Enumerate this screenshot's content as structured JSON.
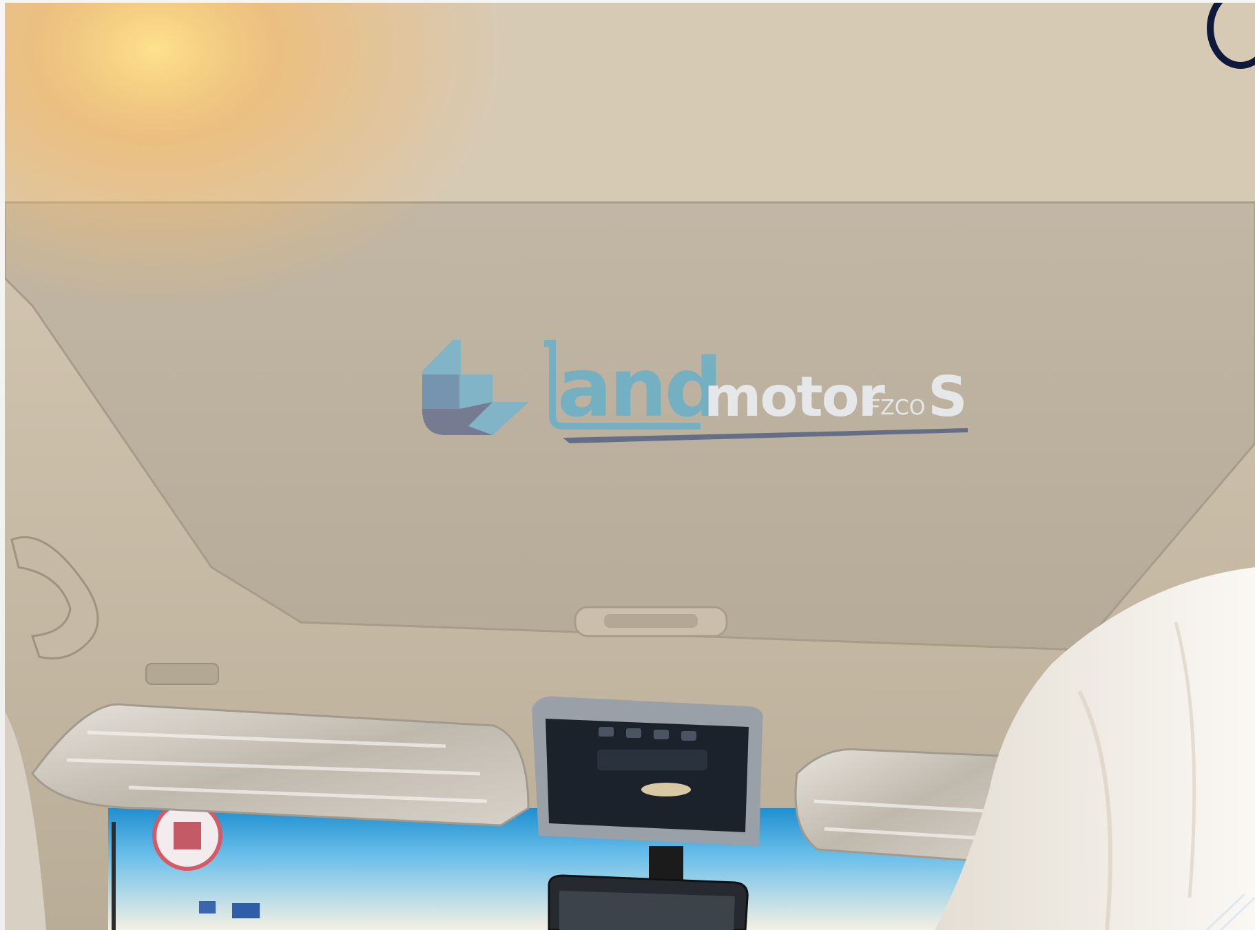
{
  "watermark": {
    "brand_primary": "land",
    "brand_secondary": "motors",
    "brand_suffix": "FZCO",
    "colors": {
      "logo_light_blue": "#78b4c9",
      "logo_dark_slate": "#6a7389",
      "wordmark_teal": "#6fb0c6",
      "wordmark_light": "#e9ecef",
      "underline_slate": "#5d6a86"
    }
  },
  "corner_badge": {
    "icon": "ring-badge-icon",
    "color": "#0f1a3a"
  },
  "scene": {
    "subject": "car-headliner-sunroof-shade",
    "colors": {
      "headliner": "#c7bba7",
      "headliner_light": "#ddd3c3",
      "shade_panel": "#bfb4a2",
      "console_dark": "#1c222c",
      "console_trim": "#9aa0a8",
      "windshield_sky": "#2a9ad6",
      "protective_plastic": "#d9d4cc",
      "passenger_wrap": "#f1ede6",
      "sun_flare": "#f5c56a"
    }
  }
}
